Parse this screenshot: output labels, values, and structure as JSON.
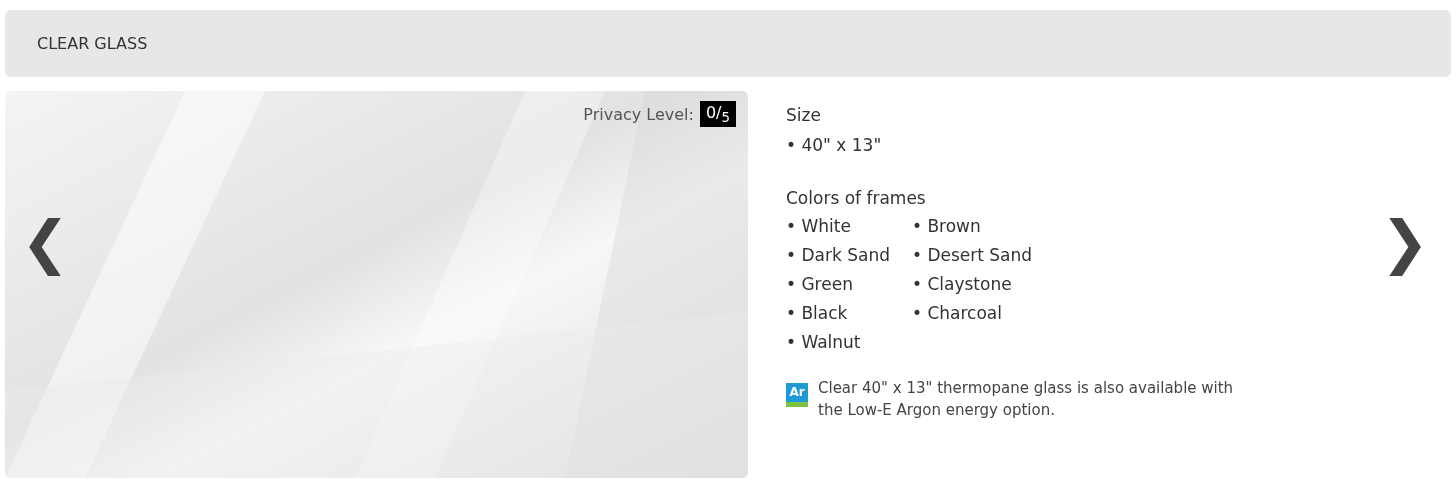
{
  "header": {
    "title": "CLEAR GLASS"
  },
  "gallery": {
    "prev": "❮",
    "next": "❯",
    "privacy_label": "Privacy Level:",
    "privacy_value": "0/$_{5}$"
  },
  "details": {
    "size_heading": "Size",
    "sizes": [
      "• 40\" x 13\""
    ],
    "colors_heading": "Colors of frames",
    "colors_left": [
      "• White",
      "• Dark Sand",
      "• Green",
      "• Black",
      "• Walnut"
    ],
    "colors_right": [
      "• Brown",
      "• Desert Sand",
      "• Claystone",
      "• Charcoal"
    ],
    "note": {
      "badge": "Ar",
      "text": "Clear 40\" x 13\" thermopane glass is also available with the Low-E Argon energy option."
    }
  }
}
